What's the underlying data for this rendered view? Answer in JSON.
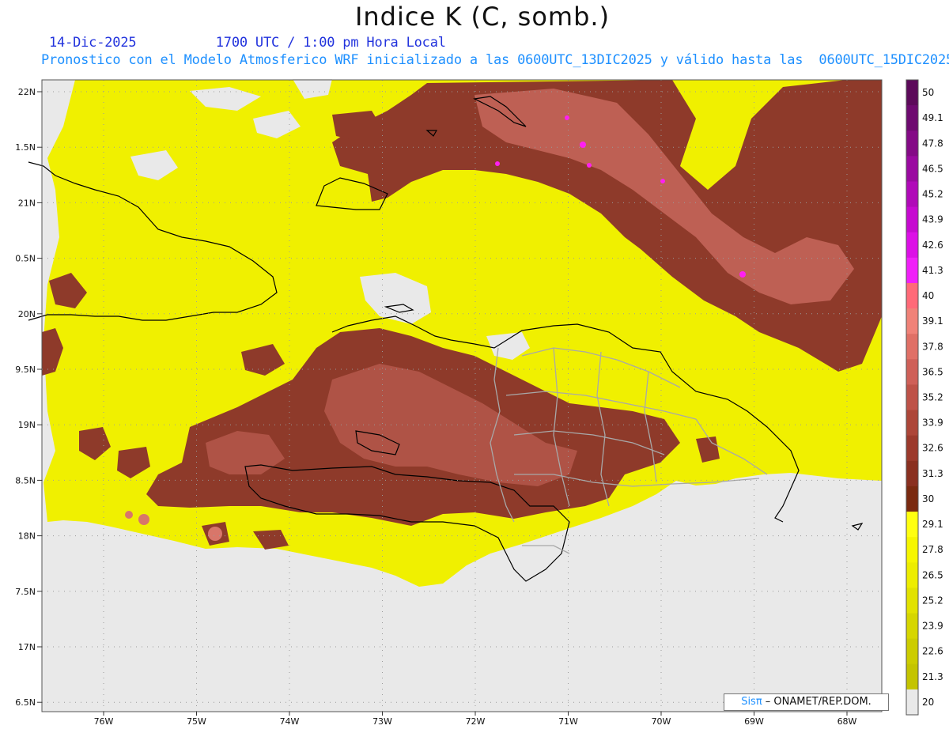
{
  "title": "Indice K (C, somb.)",
  "date": "14-Dic-2025",
  "time": "1700 UTC / 1:00 pm Hora Local",
  "subtitle": "Pronostico con el Modelo Atmosferico WRF inicializado a las 0600UTC_13DIC2025 y válido hasta las  0600UTC_15DIC2025",
  "credit": {
    "logo": "Sisπ",
    "text": " – ONAMET/REP.DOM."
  },
  "y_ticks": [
    "22N",
    "1.5N",
    "21N",
    "0.5N",
    "20N",
    "9.5N",
    "19N",
    "8.5N",
    "18N",
    "7.5N",
    "17N",
    "6.5N"
  ],
  "x_ticks": [
    "76W",
    "75W",
    "74W",
    "73W",
    "72W",
    "71W",
    "70W",
    "69W",
    "68W"
  ],
  "colors": {
    "background": "#e9e9e9",
    "yellow": "#f0f000",
    "yellow_dark": "#e4e40a",
    "brown": "#8e3a2a",
    "brown_mid": "#a24a3c",
    "pink": "#cf6a62",
    "magenta": "#ff1ff2",
    "coast": "#000000",
    "border": "#a8a8a8"
  },
  "colorbar": [
    {
      "label": "50",
      "color": "#5c0a5a"
    },
    {
      "label": "49.1",
      "color": "#6e0a70"
    },
    {
      "label": "47.8",
      "color": "#840a86"
    },
    {
      "label": "46.5",
      "color": "#9a0aa0"
    },
    {
      "label": "45.2",
      "color": "#b00ab8"
    },
    {
      "label": "43.9",
      "color": "#c60ad0"
    },
    {
      "label": "42.6",
      "color": "#dc10e6"
    },
    {
      "label": "41.3",
      "color": "#f020f8"
    },
    {
      "label": "40",
      "color": "#ff6a78"
    },
    {
      "label": "39.1",
      "color": "#f08278"
    },
    {
      "label": "37.8",
      "color": "#e07066"
    },
    {
      "label": "36.5",
      "color": "#cf6058"
    },
    {
      "label": "35.2",
      "color": "#be5248"
    },
    {
      "label": "33.9",
      "color": "#ad4638"
    },
    {
      "label": "32.6",
      "color": "#9c3a2c"
    },
    {
      "label": "31.3",
      "color": "#8a3020"
    },
    {
      "label": "30",
      "color": "#7a2a10"
    },
    {
      "label": "29.1",
      "color": "#ffff10"
    },
    {
      "label": "27.8",
      "color": "#f6f600"
    },
    {
      "label": "26.5",
      "color": "#eded00"
    },
    {
      "label": "25.2",
      "color": "#e2e200"
    },
    {
      "label": "23.9",
      "color": "#d6d600"
    },
    {
      "label": "22.6",
      "color": "#cccc00"
    },
    {
      "label": "21.3",
      "color": "#c4c400"
    },
    {
      "label": "20",
      "color": "#e9e9e9"
    }
  ]
}
